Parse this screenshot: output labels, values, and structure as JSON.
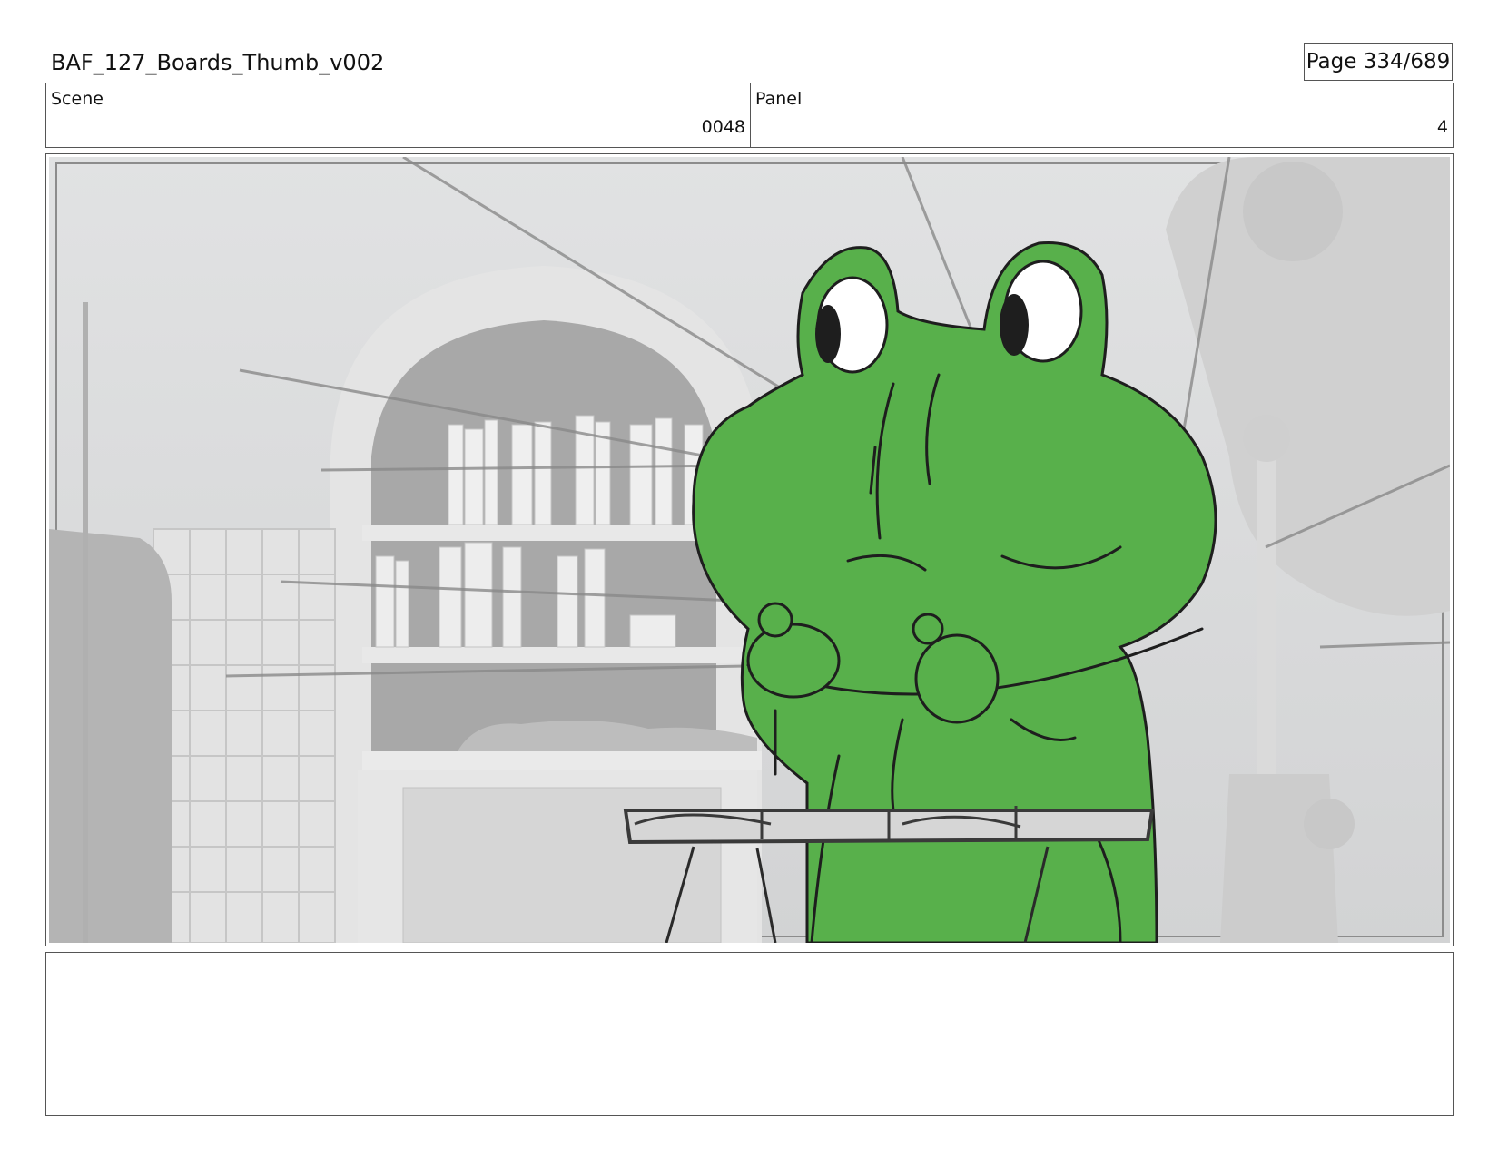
{
  "header": {
    "title": "BAF_127_Boards_Thumb_v002",
    "page": "Page 334/689"
  },
  "info": {
    "scene_label": "Scene",
    "scene_value": "0048",
    "panel_label": "Panel",
    "panel_value": "4"
  },
  "panel_image": {
    "character_color": "#58b04b",
    "background_color": "#d9dadb"
  },
  "notes": {
    "text": ""
  }
}
